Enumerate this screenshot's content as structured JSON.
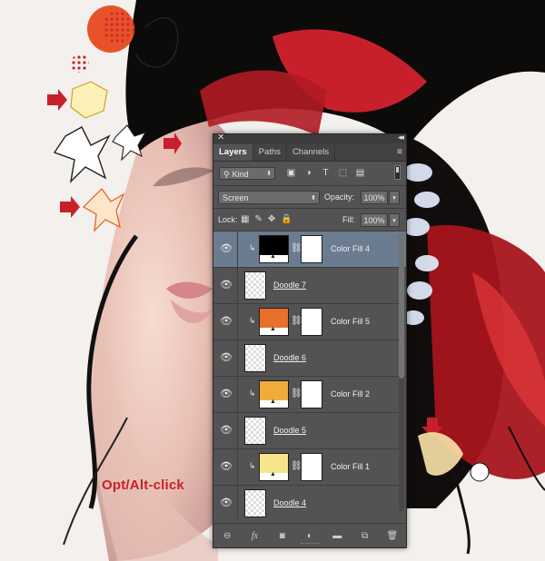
{
  "annotation": {
    "text": "Opt/Alt-click"
  },
  "panel": {
    "close": "✕",
    "collapse": "◂◂",
    "tabs": [
      {
        "label": "Layers"
      },
      {
        "label": "Paths"
      },
      {
        "label": "Channels"
      }
    ],
    "tab_menu": "≡",
    "filter": {
      "kind_label": "Kind",
      "icons": [
        "image-filter-icon",
        "adjustment-filter-icon",
        "type-filter-icon",
        "shape-filter-icon",
        "smart-object-filter-icon"
      ]
    },
    "blend_mode": "Screen",
    "opacity_label": "Opacity:",
    "opacity_value": "100%",
    "lock_label": "Lock:",
    "fill_label": "Fill:",
    "fill_value": "100%",
    "layers": [
      {
        "name": "Color Fill 4",
        "type": "fill",
        "color": "#000000",
        "selected": true
      },
      {
        "name": "Doodle 7",
        "type": "pixel"
      },
      {
        "name": "Color Fill 5",
        "type": "fill",
        "color": "#e8702a"
      },
      {
        "name": "Doodle 6",
        "type": "pixel"
      },
      {
        "name": "Color Fill 2",
        "type": "fill",
        "color": "#f0ac3a"
      },
      {
        "name": "Doodle 5",
        "type": "pixel"
      },
      {
        "name": "Color Fill 1",
        "type": "fill",
        "color": "#f6e58a"
      },
      {
        "name": "Doodle 4",
        "type": "pixel"
      }
    ],
    "bottom_icons": [
      "link-icon",
      "fx-icon",
      "mask-icon",
      "adjustment-icon",
      "folder-icon",
      "new-layer-icon",
      "trash-icon"
    ],
    "fx_label": "fx"
  },
  "colors": {
    "accent_red": "#c8202b",
    "selected_row": "#6b7c90",
    "panel_bg": "#535353"
  }
}
